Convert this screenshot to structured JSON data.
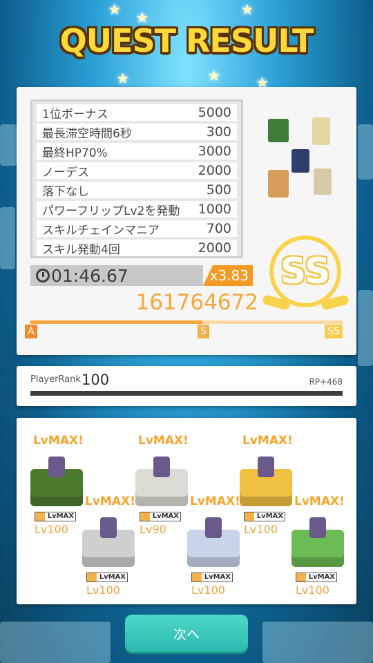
{
  "title": "QUEST RESULT",
  "bonuses": [
    {
      "label": "1位ボーナス",
      "points": "5000"
    },
    {
      "label": "最長滞空時間6秒",
      "points": "300"
    },
    {
      "label": "最終HP70%",
      "points": "3000"
    },
    {
      "label": "ノーデス",
      "points": "2000"
    },
    {
      "label": "落下なし",
      "points": "500"
    },
    {
      "label": "パワーフリップLv2を発動",
      "points": "1000"
    },
    {
      "label": "スキルチェインマニア",
      "points": "700"
    },
    {
      "label": "スキル発動4回",
      "points": "2000"
    }
  ],
  "clear_time": "01:46.67",
  "multiplier": "x3.83",
  "score": "161764672",
  "rank": "SS",
  "gauge": {
    "fill_fraction": 0.55,
    "ticks": [
      "A",
      "S",
      "SS"
    ]
  },
  "player_rank": {
    "label": "PlayerRank",
    "value": "100",
    "rp": "RP+468"
  },
  "units": [
    {
      "badge": "LvMAX!",
      "tag": "LvMAX",
      "level": "Lv100",
      "block_color": "#4b7a2f"
    },
    {
      "badge": "LvMAX!",
      "tag": "LvMAX",
      "level": "Lv100",
      "block_color": "#cfcfcf"
    },
    {
      "badge": "LvMAX!",
      "tag": "LvMAX",
      "level": "Lv90",
      "block_color": "#dcdcd4"
    },
    {
      "badge": "LvMAX!",
      "tag": "LvMAX",
      "level": "Lv100",
      "block_color": "#c9d4ea"
    },
    {
      "badge": "LvMAX!",
      "tag": "LvMAX",
      "level": "Lv100",
      "block_color": "#f0c040"
    },
    {
      "badge": "LvMAX!",
      "tag": "LvMAX",
      "level": "Lv100",
      "block_color": "#6dbb55"
    }
  ],
  "next_button": "次へ",
  "colors": {
    "accent_orange": "#f7a73b",
    "rank_gold": "#fbd24c",
    "button_teal": "#2bb8ac"
  }
}
